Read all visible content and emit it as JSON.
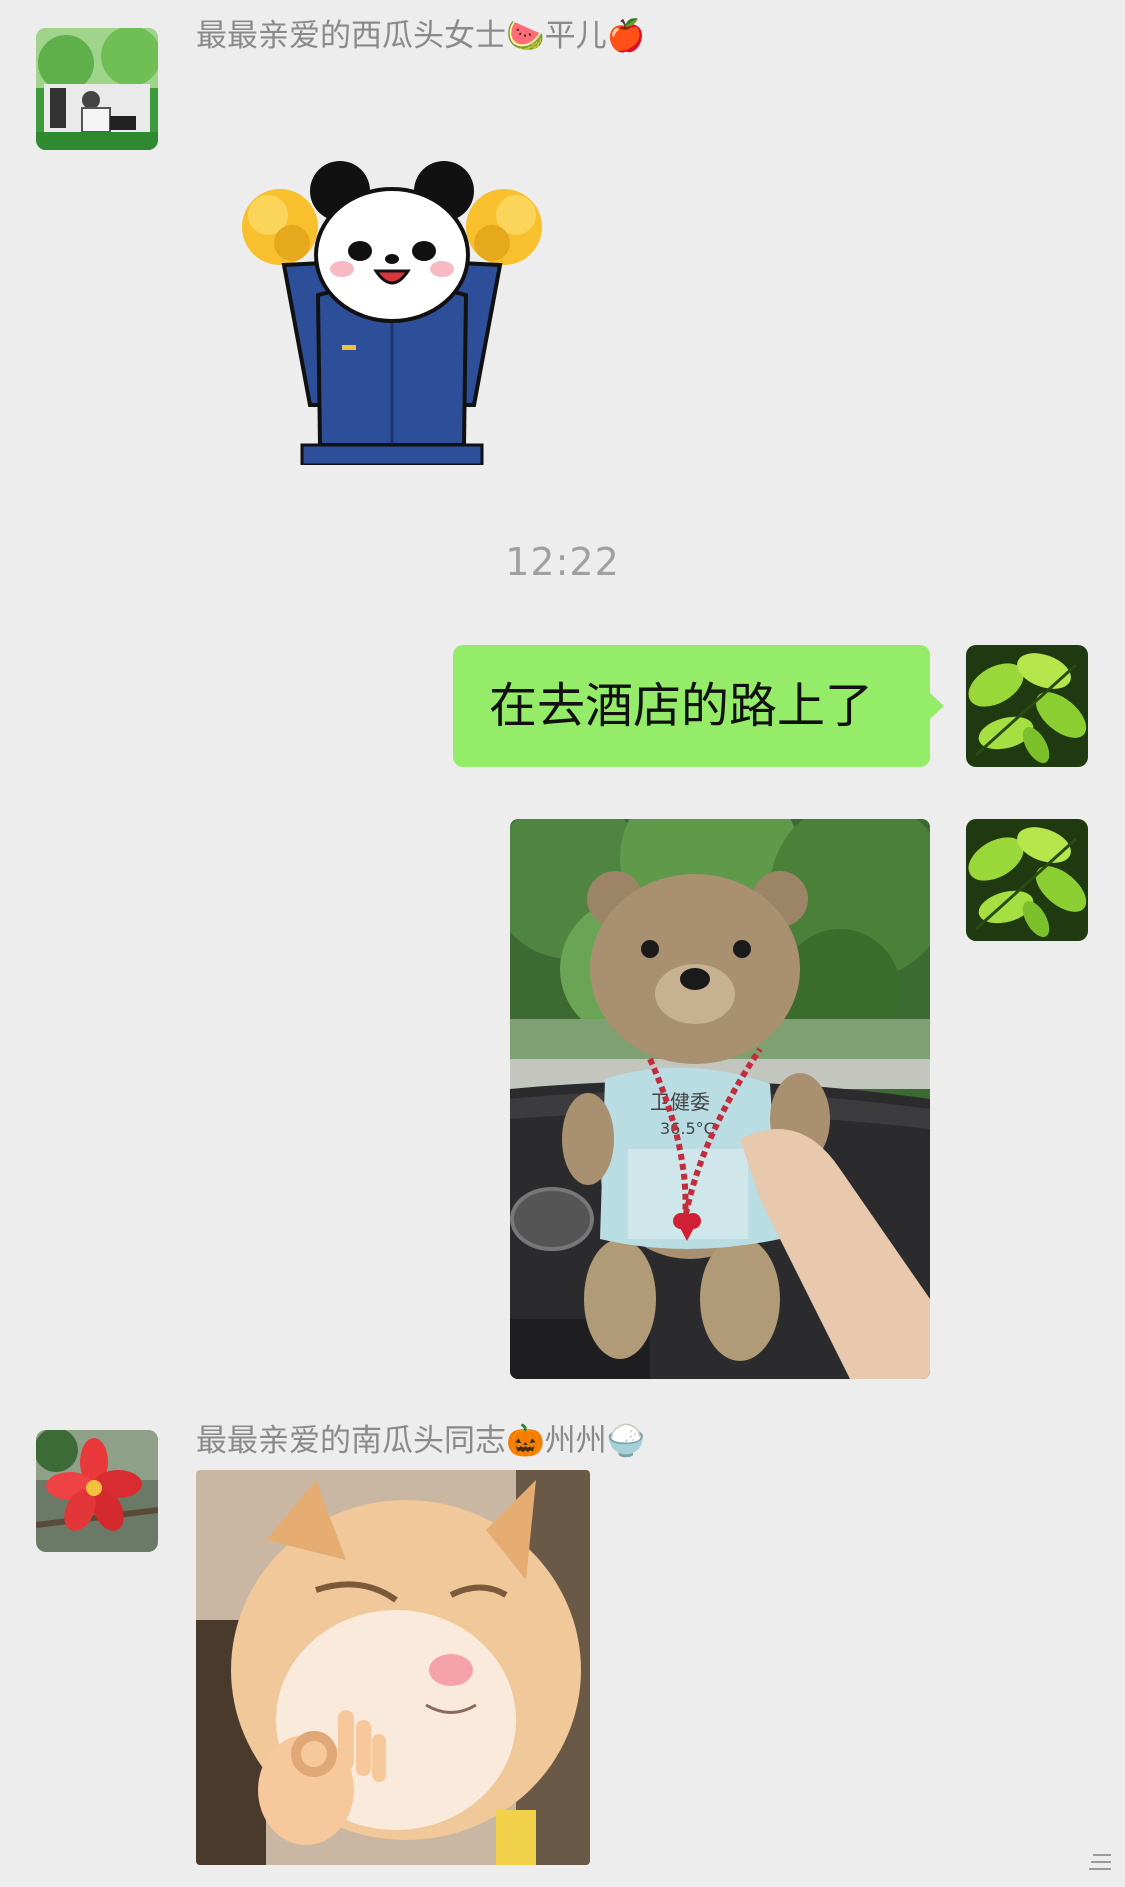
{
  "chat": {
    "timestamp": "12:22",
    "messages": [
      {
        "sender_name": "最最亲爱的西瓜头女士🍉平儿🍎",
        "type": "sticker",
        "sticker_icon": "panda-cheerleader-sticker"
      },
      {
        "type": "text",
        "direction": "outgoing",
        "text": "在去酒店的路上了"
      },
      {
        "type": "image",
        "direction": "outgoing",
        "image_icon": "teddy-bear-photo",
        "printed_text": [
          "卫健委",
          "36.5°C"
        ]
      },
      {
        "sender_name": "最最亲爱的南瓜头同志🎃州州🍚",
        "type": "image",
        "image_icon": "kitten-ok-hand-photo"
      }
    ]
  },
  "colors": {
    "background": "#ededed",
    "bubble_outgoing": "#95ec69",
    "sender_name": "#8a8a8a",
    "timestamp": "#a0a0a0"
  }
}
